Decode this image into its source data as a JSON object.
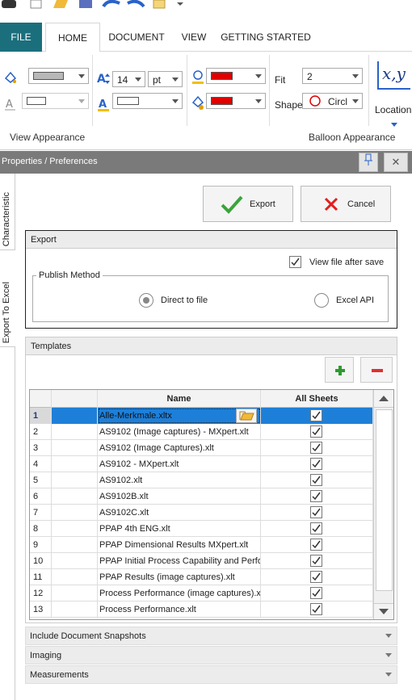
{
  "ribbon": {
    "tabs": [
      "FILE",
      "HOME",
      "DOCUMENT",
      "VIEW",
      "GETTING STARTED"
    ],
    "font_size": "14",
    "font_unit": "pt",
    "fit_label": "Fit",
    "fit_value": "2",
    "shape_label": "Shape",
    "shape_value": "Circl",
    "location_label": "Location",
    "group_view": "View Appearance",
    "group_balloon": "Balloon Appearance",
    "colors": {
      "brand": "#1b6f7d",
      "red": "#e00000",
      "gray": "#b8b8b8",
      "selection": "#1e7fd8"
    }
  },
  "panel": {
    "title": "Properties / Preferences",
    "vtabs": [
      "Characteristic",
      "Export To Excel"
    ]
  },
  "actions": {
    "export": "Export",
    "cancel": "Cancel"
  },
  "export_section": {
    "header": "Export",
    "view_after_save": "View file after save",
    "publish_method": "Publish Method",
    "direct": "Direct to file",
    "excel_api": "Excel API"
  },
  "templates": {
    "header": "Templates",
    "columns": {
      "name": "Name",
      "all_sheets": "All Sheets"
    },
    "rows": [
      {
        "n": "1",
        "name": "Alle-Merkmale.xltx"
      },
      {
        "n": "2",
        "name": "AS9102 (Image captures) - MXpert.xlt"
      },
      {
        "n": "3",
        "name": "AS9102 (Image Captures).xlt"
      },
      {
        "n": "4",
        "name": "AS9102 - MXpert.xlt"
      },
      {
        "n": "5",
        "name": "AS9102.xlt"
      },
      {
        "n": "6",
        "name": "AS9102B.xlt"
      },
      {
        "n": "7",
        "name": "AS9102C.xlt"
      },
      {
        "n": "8",
        "name": "PPAP 4th ENG.xlt"
      },
      {
        "n": "9",
        "name": "PPAP Dimensional Results MXpert.xlt"
      },
      {
        "n": "10",
        "name": "PPAP Initial Process Capability and Perforr"
      },
      {
        "n": "11",
        "name": "PPAP Results (image captures).xlt"
      },
      {
        "n": "12",
        "name": "Process Performance (image captures).xlt"
      },
      {
        "n": "13",
        "name": "Process Performance.xlt"
      }
    ]
  },
  "collapsed": [
    "Include Document Snapshots",
    "Imaging",
    "Measurements"
  ]
}
